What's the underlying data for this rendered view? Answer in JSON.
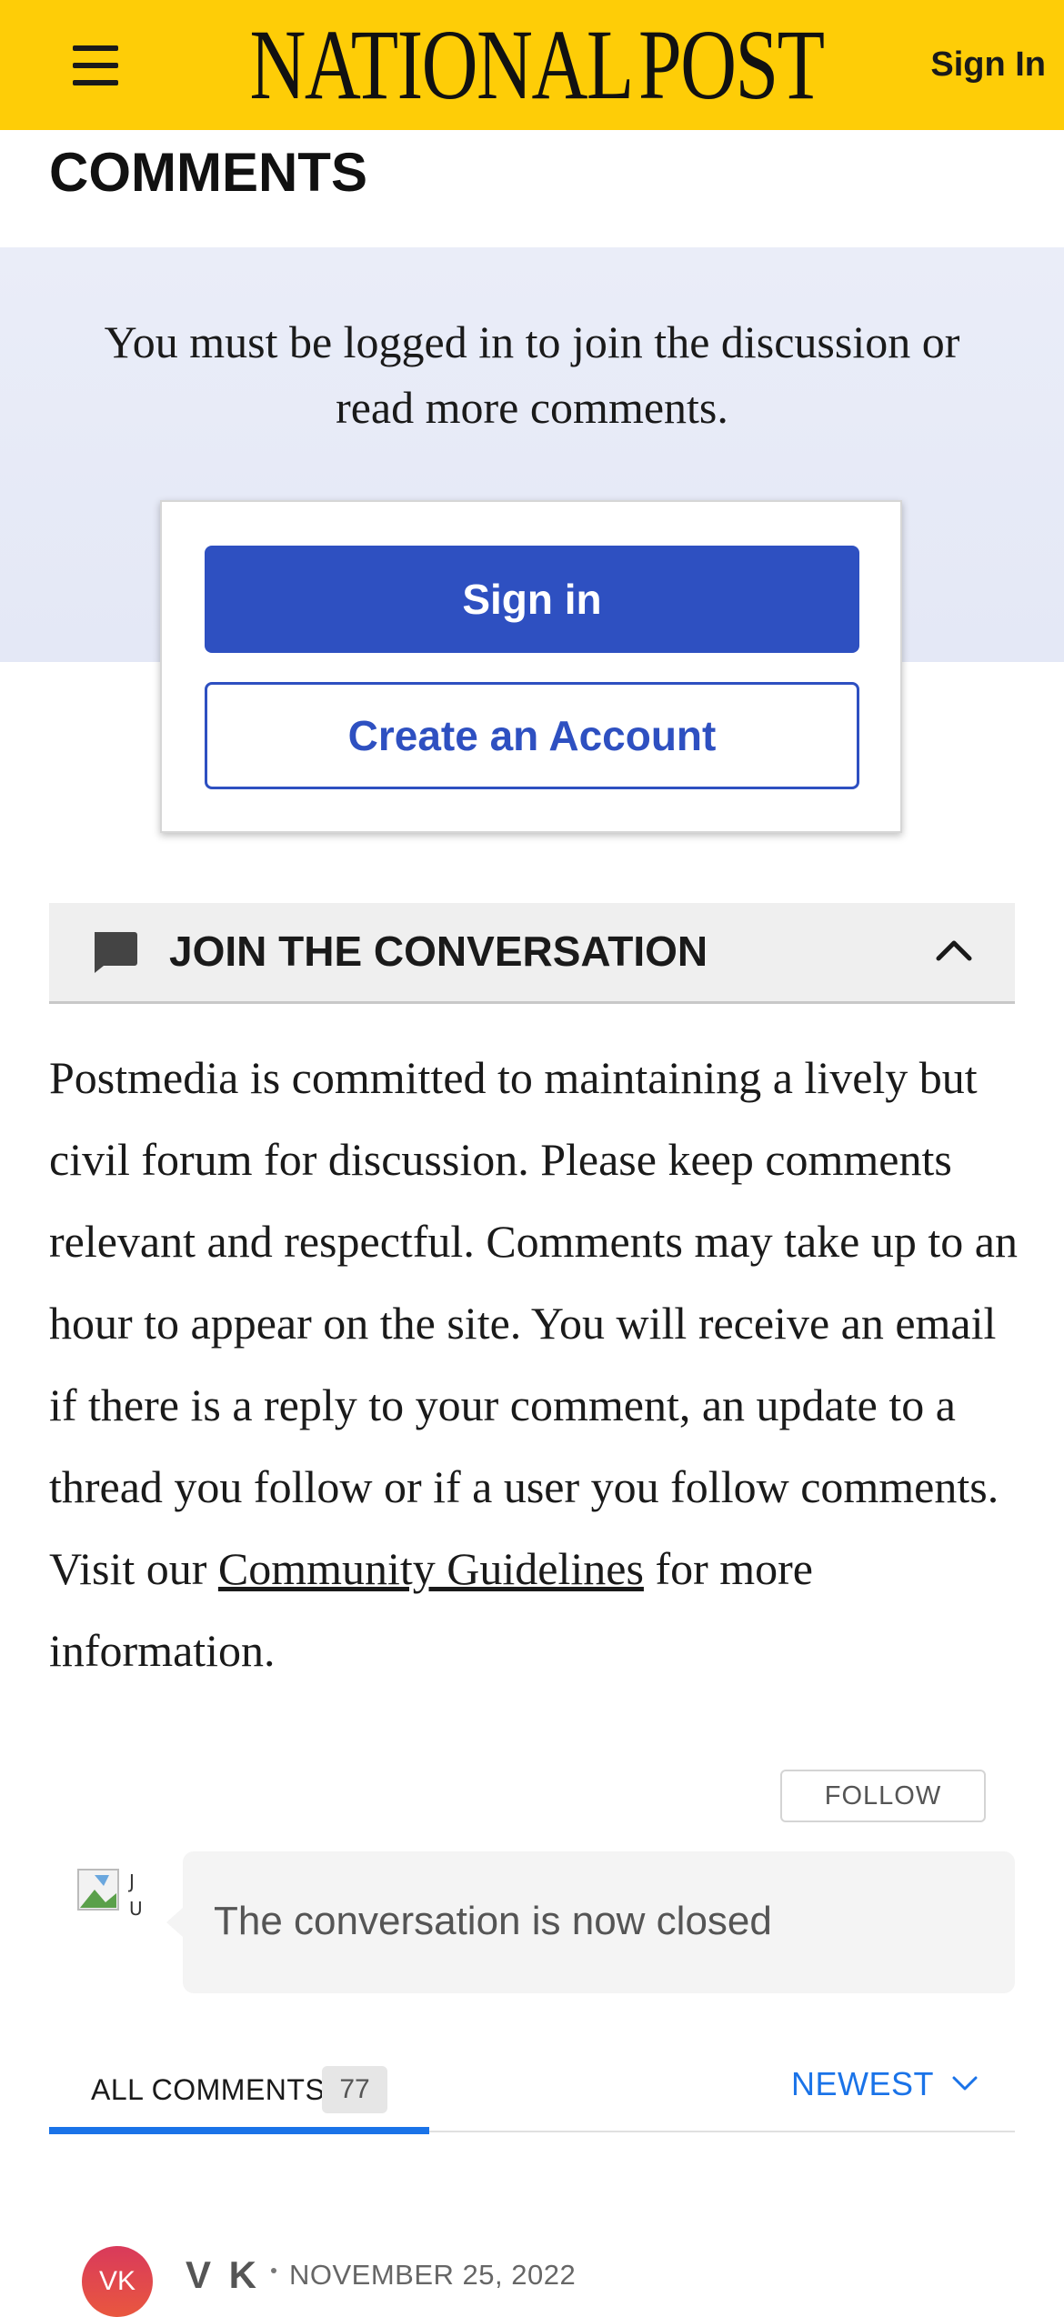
{
  "header": {
    "logo_text_1": "NATIONAL",
    "logo_text_2": "POST",
    "sign_in_label": "Sign In",
    "background_color": "#fecd07"
  },
  "section_title": "COMMENTS",
  "login_panel": {
    "message": "You must be logged in to join the discussion or read more comments.",
    "sign_in_button": "Sign in",
    "create_account_button": "Create an Account",
    "accent_color": "#2e50c1"
  },
  "join": {
    "title": "JOIN THE CONVERSATION",
    "icon": "comment-icon",
    "toggle_icon": "chevron-up-icon",
    "text_before_link": "Postmedia is committed to maintaining a lively but civil forum for discussion. Please keep comments relevant and respectful. Comments may take up to an hour to appear on the site. You will receive an email if there is a reply to your comment, an update to a thread you follow or if a user you follow comments. Visit our ",
    "link_text": "Community Guidelines",
    "text_after_link": " for more information."
  },
  "follow_button": "FOLLOW",
  "closed_message": "The conversation is now closed",
  "tabs": {
    "all_comments_label": "ALL COMMENTS",
    "count": "77",
    "sort_label": "NEWEST",
    "sort_icon": "chevron-down-icon",
    "active_color": "#1a73e8"
  },
  "first_comment": {
    "avatar_initials": "VK",
    "author": "V K",
    "date": "NOVEMBER 25, 2022"
  }
}
